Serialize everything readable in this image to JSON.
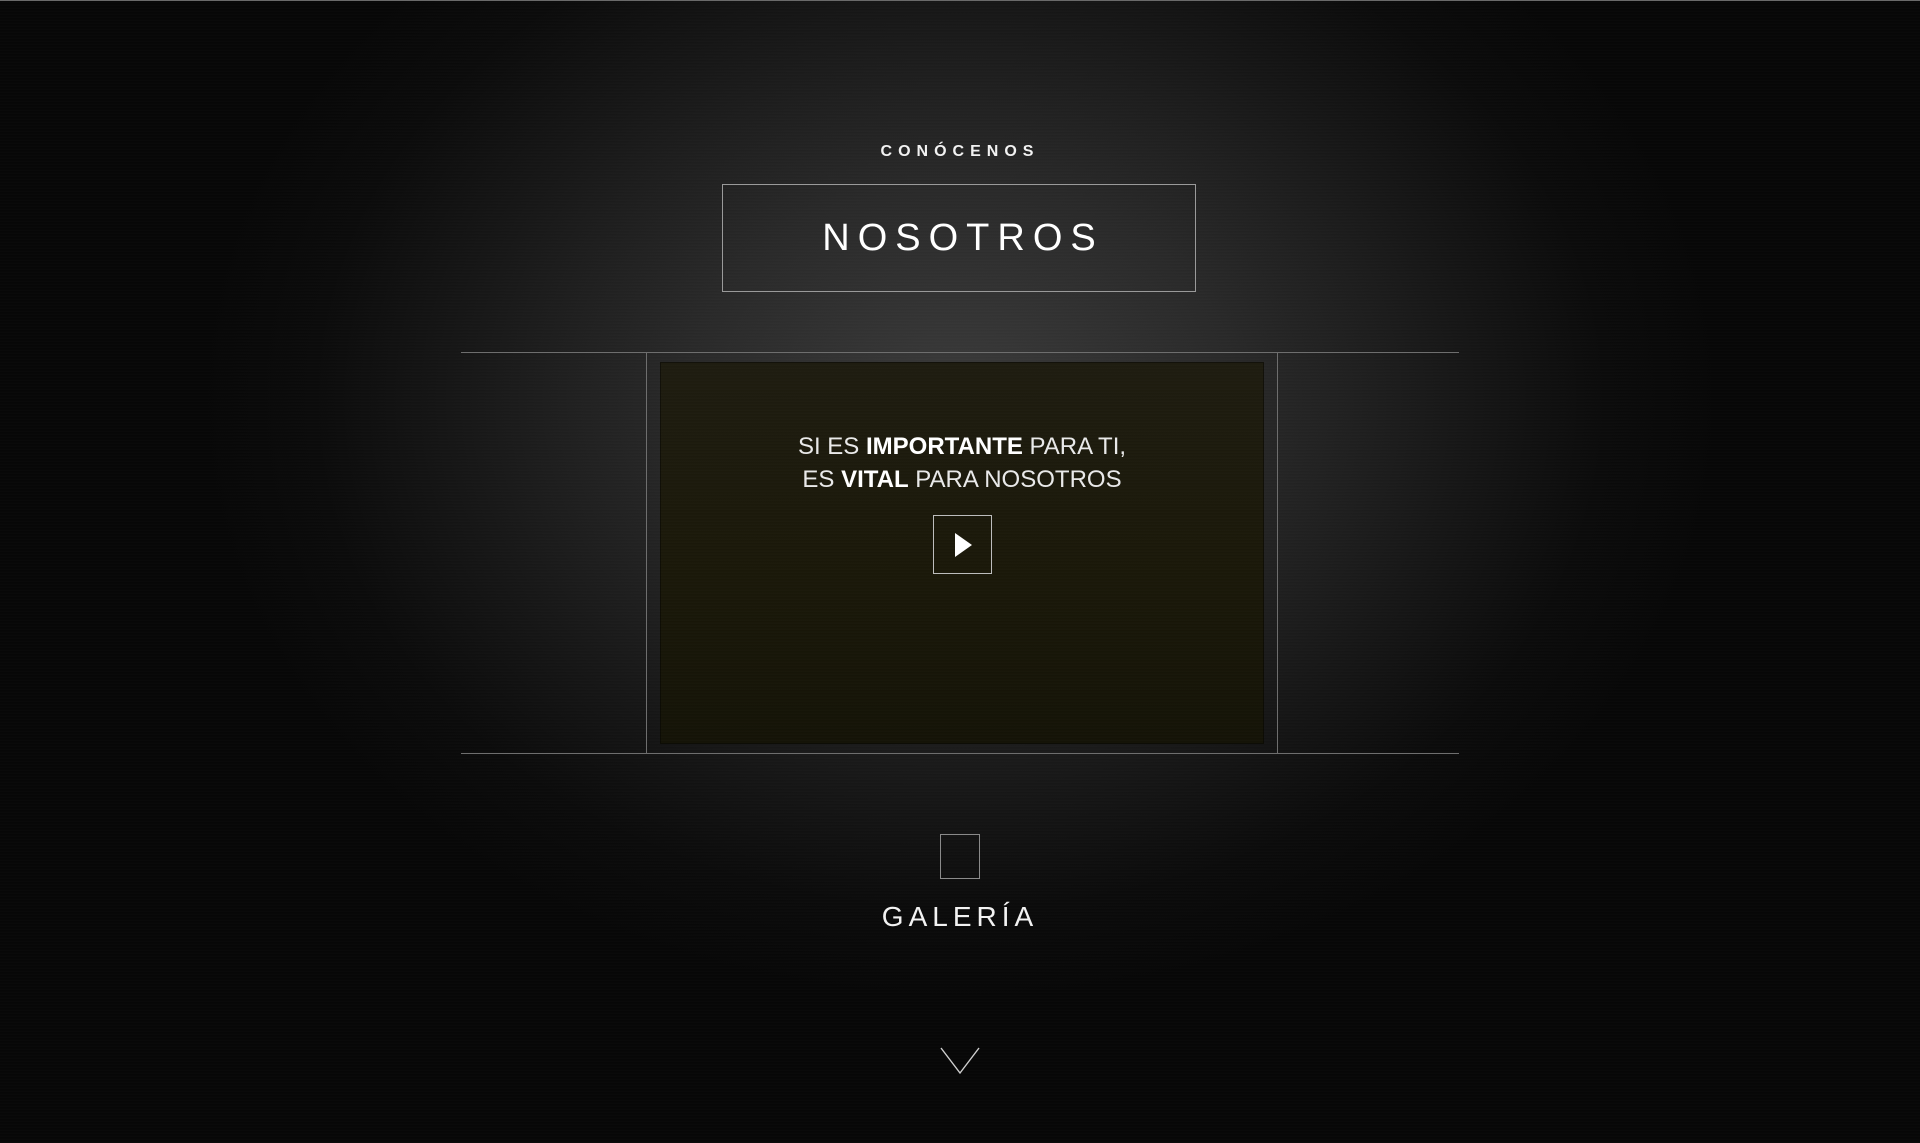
{
  "section": {
    "eyebrow": "CONÓCENOS",
    "title": "NOSOTROS"
  },
  "video": {
    "line1_pre": "SI ES ",
    "line1_bold": "IMPORTANTE",
    "line1_post": " PARA TI,",
    "line2_pre": "ES ",
    "line2_bold": "VITAL",
    "line2_post": " PARA NOSOTROS",
    "play_icon": "play-icon"
  },
  "gallery": {
    "label": "GALERÍA"
  },
  "scroll": {
    "icon": "chevron-down-icon"
  },
  "colors": {
    "background": "#0b0b0b",
    "lines": "#6e6e6e",
    "video_panel": "#1a1809",
    "text": "#ffffff"
  }
}
